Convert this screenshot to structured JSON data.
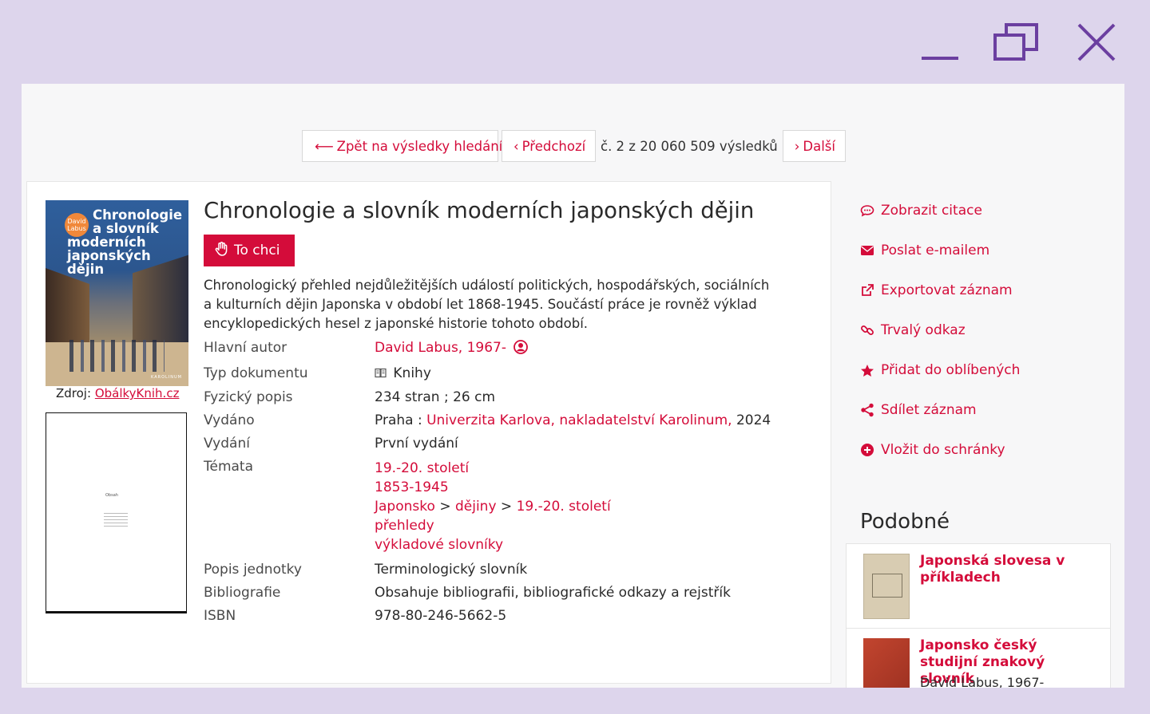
{
  "window": {
    "minimize_icon": "minimize-icon",
    "maximize_icon": "restore-icon",
    "close_icon": "close-icon",
    "accent": "#6b3fa0"
  },
  "pager": {
    "back_label": "Zpět na výsledky hledání",
    "prev_label": "Předchozí",
    "position_text": "č. 2 z 20 060 509 výsledků",
    "next_label": "Další"
  },
  "record": {
    "cover": {
      "badge": "David Labus",
      "title_lines": [
        "Chronologie",
        "a slovník",
        "moderních",
        "japonských",
        "dějin"
      ],
      "brand": "KAROLINUM"
    },
    "source_label": "Zdroj:",
    "source_link": "ObálkyKnih.cz",
    "toc_heading": "Obsah",
    "title": "Chronologie a slovník moderních japonských dějin",
    "want_button": "To chci",
    "abstract": "Chronologický přehled nejdůležitějších událostí politických, hospodářských, sociálních a kulturních dějin Japonska v období let 1868-1945. Součástí práce je rovněž výklad encyklopedických hesel z japonské historie tohoto období.",
    "fields": {
      "author_label": "Hlavní autor",
      "author_value": "David Labus, 1967-",
      "doctype_label": "Typ dokumentu",
      "doctype_value": "Knihy",
      "physical_label": "Fyzický popis",
      "physical_value": "234 stran ; 26 cm",
      "published_label": "Vydáno",
      "published_place": "Praha :",
      "published_publisher": "Univerzita Karlova, nakladatelství Karolinum,",
      "published_year": "2024",
      "edition_label": "Vydání",
      "edition_value": "První vydání",
      "topics_label": "Témata",
      "topic_1": "19.-20. století",
      "topic_2": "1853-1945",
      "topic_3a": "Japonsko",
      "topic_sep": ">",
      "topic_3b": "dějiny",
      "topic_3c": "19.-20. století",
      "topic_4": "přehledy",
      "topic_5": "výkladové slovníky",
      "unit_label": "Popis jednotky",
      "unit_value": "Terminologický slovník",
      "biblio_label": "Bibliografie",
      "biblio_value": "Obsahuje bibliografii, bibliografické odkazy a rejstřík",
      "isbn_label": "ISBN",
      "isbn_value": "978-80-246-5662-5"
    }
  },
  "sidebar": {
    "cite": "Zobrazit citace",
    "email": "Poslat e-mailem",
    "export": "Exportovat záznam",
    "permalink": "Trvalý odkaz",
    "favorite": "Přidat do oblíbených",
    "share": "Sdílet záznam",
    "clipboard": "Vložit do schránky"
  },
  "similar": {
    "heading": "Podobné",
    "item1_title": "Japonská slovesa v příkladech",
    "item2_title": "Japonsko český studijní znakový slovník",
    "item2_author": "David Labus, 1967-"
  },
  "colors": {
    "link": "#d40c3a",
    "background": "#ddd5ec"
  }
}
